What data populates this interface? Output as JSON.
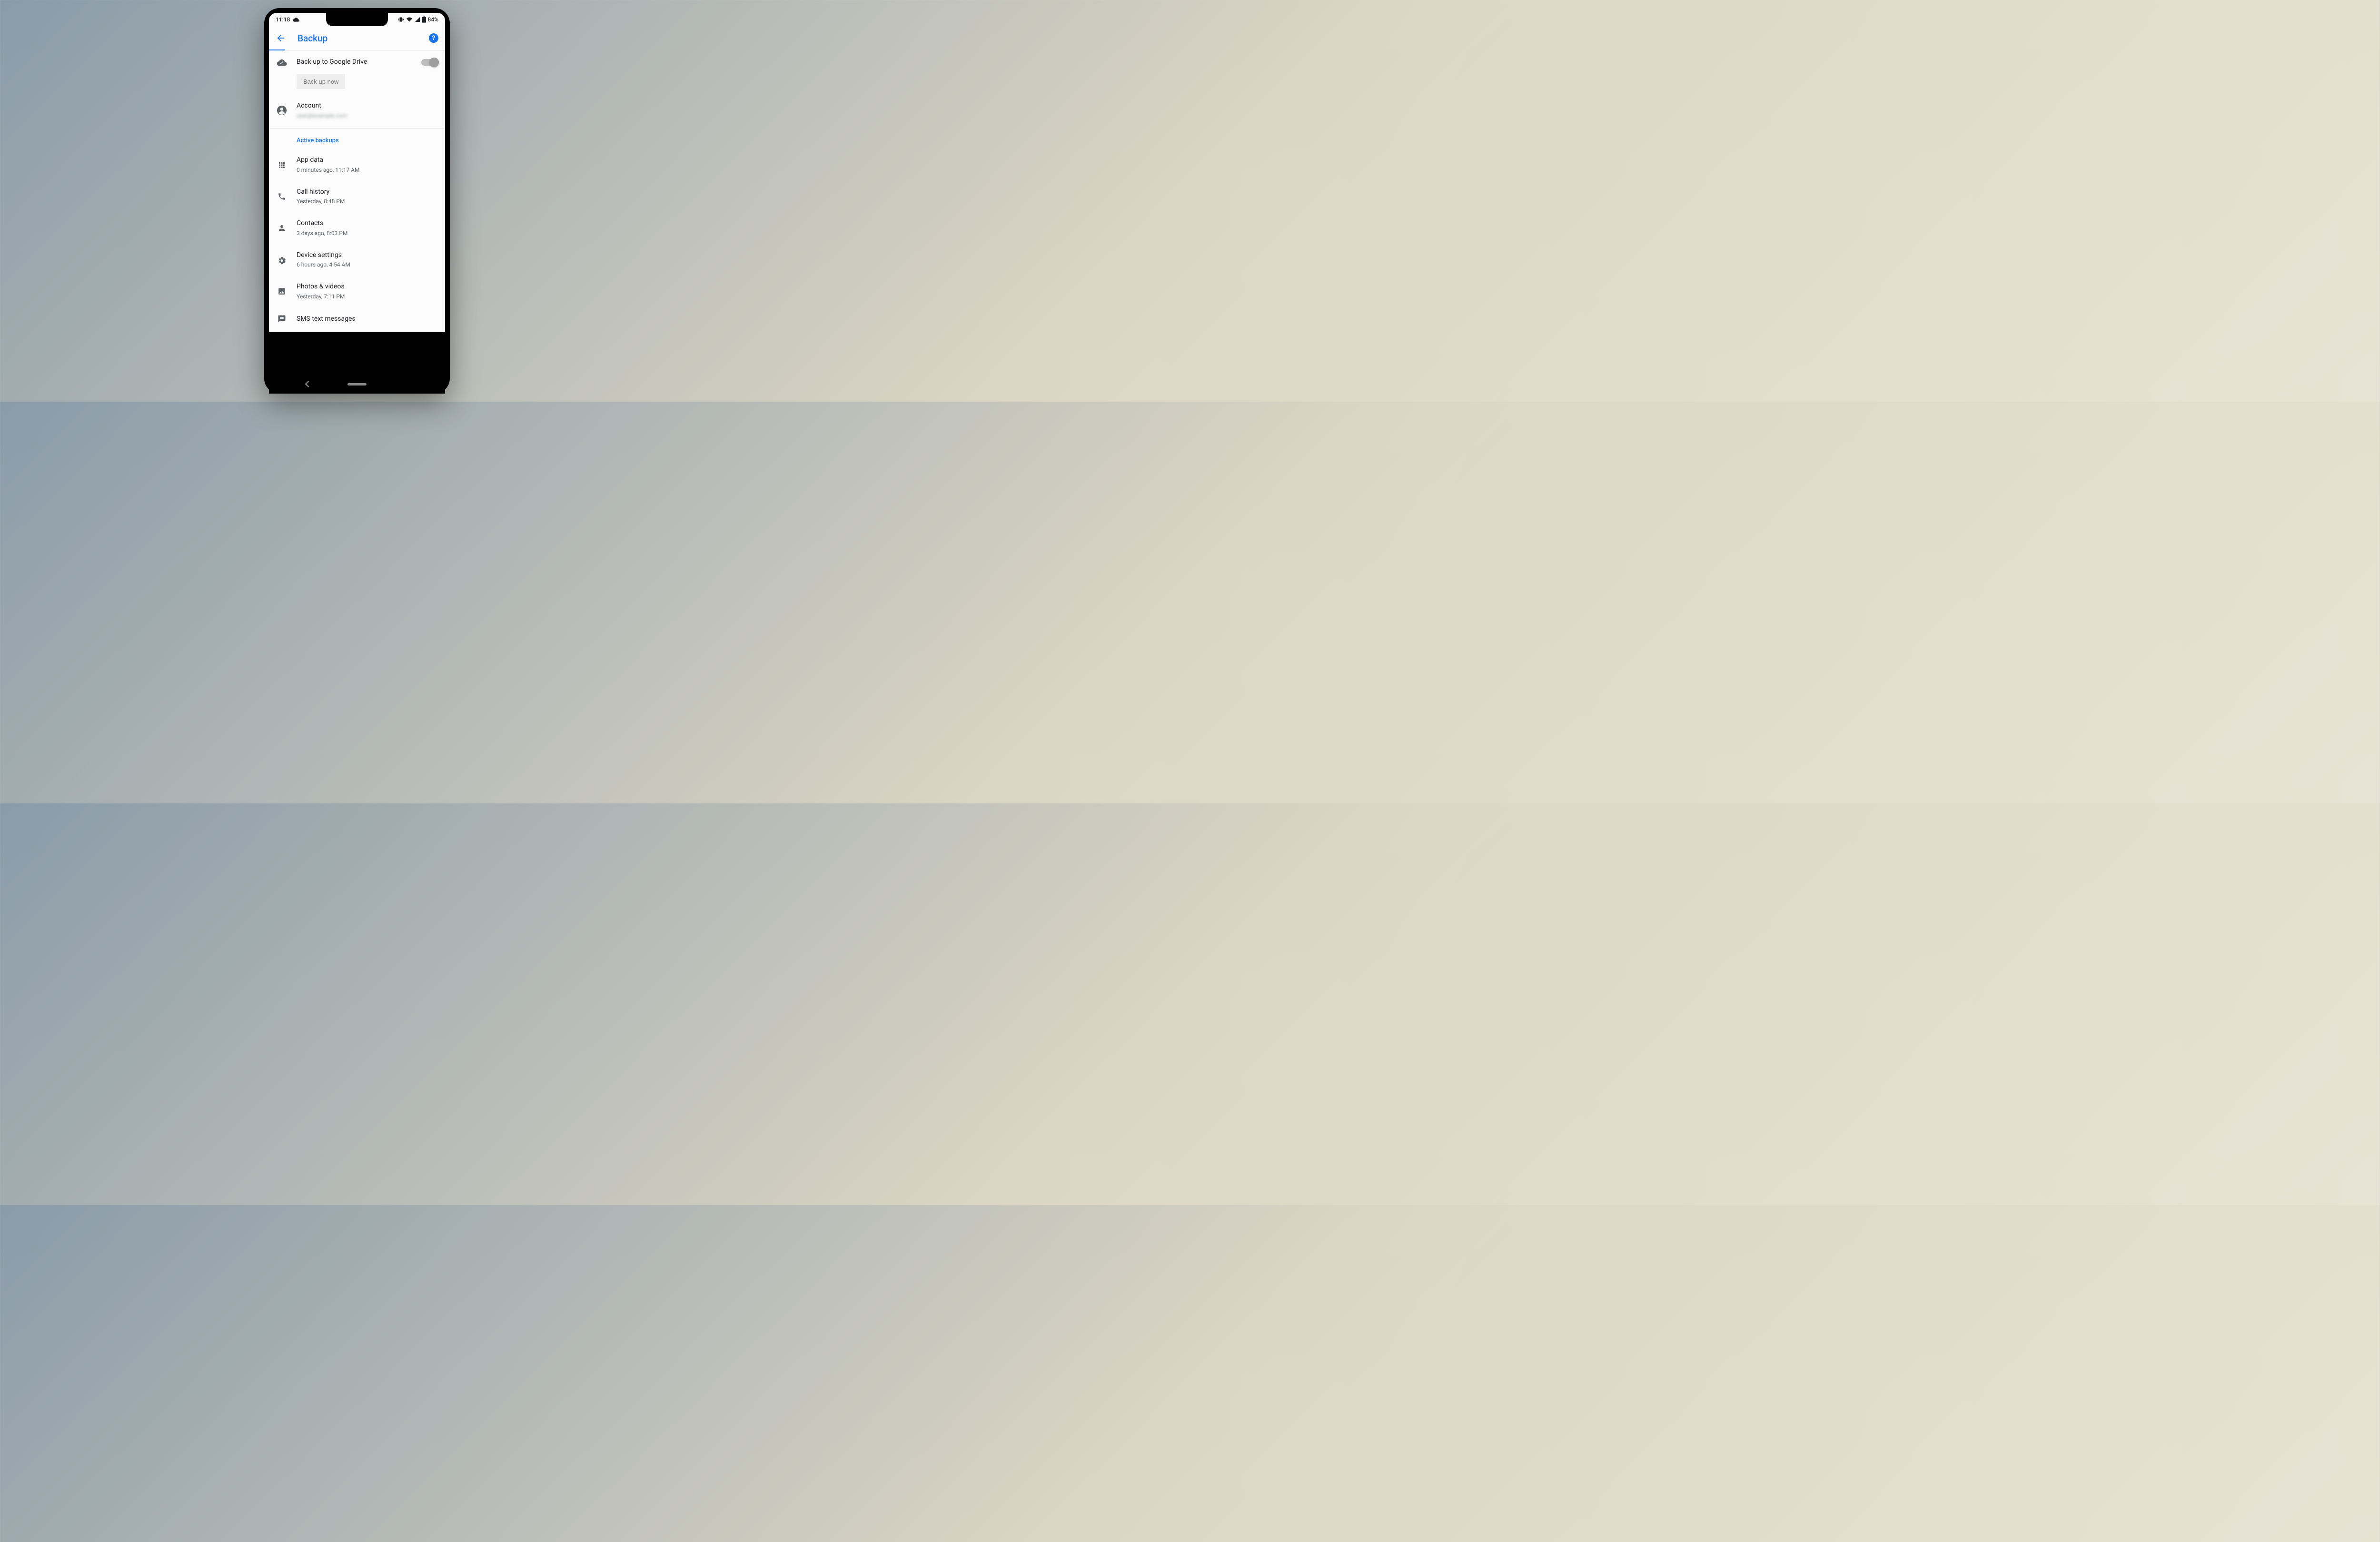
{
  "status_bar": {
    "time": "11:18",
    "battery_percent": "84%"
  },
  "header": {
    "title": "Backup"
  },
  "backup": {
    "toggle_label": "Back up to Google Drive",
    "button_label": "Back up now",
    "account_label": "Account",
    "account_email": "user@example.com"
  },
  "section": {
    "active_backups": "Active backups"
  },
  "items": [
    {
      "title": "App data",
      "sub": "0 minutes ago, 11:17 AM",
      "icon": "apps"
    },
    {
      "title": "Call history",
      "sub": "Yesterday, 8:48 PM",
      "icon": "phone"
    },
    {
      "title": "Contacts",
      "sub": "3 days ago, 8:03 PM",
      "icon": "person"
    },
    {
      "title": "Device settings",
      "sub": "6 hours ago, 4:54 AM",
      "icon": "gear"
    },
    {
      "title": "Photos & videos",
      "sub": "Yesterday, 7:11 PM",
      "icon": "image"
    },
    {
      "title": "SMS text messages",
      "sub": "",
      "icon": "sms"
    }
  ]
}
